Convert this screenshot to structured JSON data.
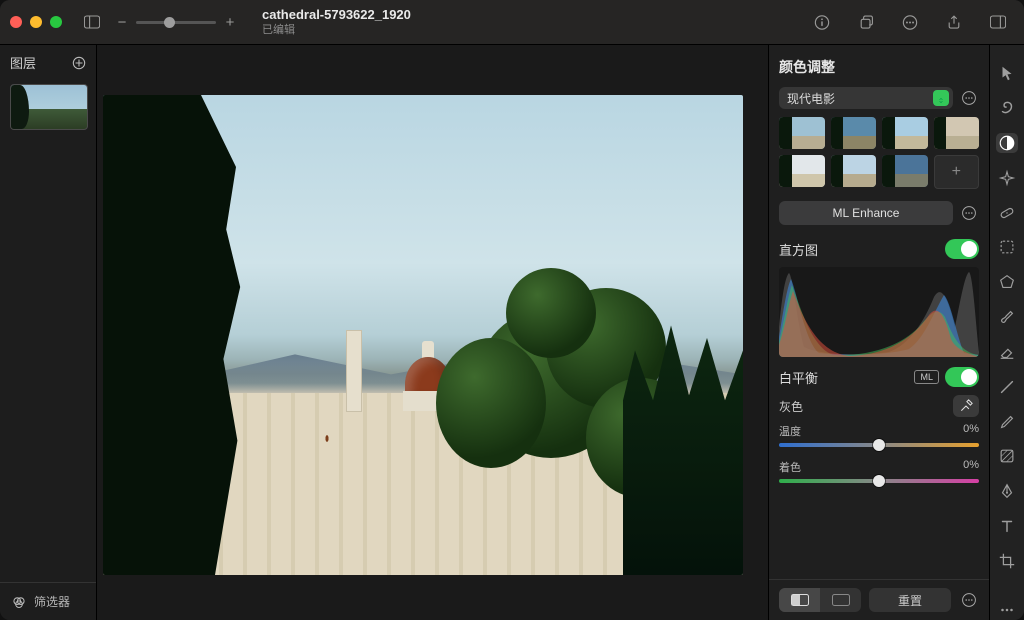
{
  "titlebar": {
    "filename": "cathedral-5793622_1920",
    "status": "已编辑"
  },
  "layers": {
    "title": "图层",
    "filter_label": "筛选器"
  },
  "inspector": {
    "title": "颜色调整",
    "preset": "现代电影",
    "ml_enhance": "ML Enhance",
    "histogram_label": "直方图",
    "white_balance_label": "白平衡",
    "ml_badge": "ML",
    "gray_label": "灰色",
    "temperature": {
      "label": "温度",
      "value": "0%",
      "pos_pct": 50
    },
    "tint": {
      "label": "着色",
      "value": "0%",
      "pos_pct": 50
    },
    "reset_label": "重置",
    "preset_thumbs": [
      {
        "sky": "#9ec1d3",
        "ground": "#b7ad92"
      },
      {
        "sky": "#5a8aaa",
        "ground": "#8c8566"
      },
      {
        "sky": "#a9cde2",
        "ground": "#c3b99b"
      },
      {
        "sky": "#d2c7b2",
        "ground": "#b9af93"
      },
      {
        "sky": "#e2e7ea",
        "ground": "#cfc6ab"
      },
      {
        "sky": "#bcd4e4",
        "ground": "#b6ab8e"
      },
      {
        "sky": "#4b7499",
        "ground": "#7a7c6b"
      },
      {
        "add": true
      }
    ]
  },
  "tools": [
    {
      "name": "pointer",
      "active": false,
      "icon": "cursor"
    },
    {
      "name": "styles",
      "active": false,
      "icon": "brush-swirl"
    },
    {
      "name": "color-adjust",
      "active": true,
      "icon": "half-circle"
    },
    {
      "name": "effects",
      "active": false,
      "icon": "sparkle"
    },
    {
      "name": "retouch",
      "active": false,
      "icon": "bandaid"
    },
    {
      "name": "select",
      "active": false,
      "icon": "marquee"
    },
    {
      "name": "shape",
      "active": false,
      "icon": "polygon"
    },
    {
      "name": "paint",
      "active": false,
      "icon": "paint"
    },
    {
      "name": "erase",
      "active": false,
      "icon": "eraser"
    },
    {
      "name": "smudge",
      "active": false,
      "icon": "line"
    },
    {
      "name": "clone",
      "active": false,
      "icon": "pencil"
    },
    {
      "name": "gradient",
      "active": false,
      "icon": "gradient"
    },
    {
      "name": "pen",
      "active": false,
      "icon": "pen"
    },
    {
      "name": "type",
      "active": false,
      "icon": "type"
    },
    {
      "name": "crop",
      "active": false,
      "icon": "crop"
    },
    {
      "name": "zoom",
      "active": false,
      "icon": "dots"
    }
  ]
}
